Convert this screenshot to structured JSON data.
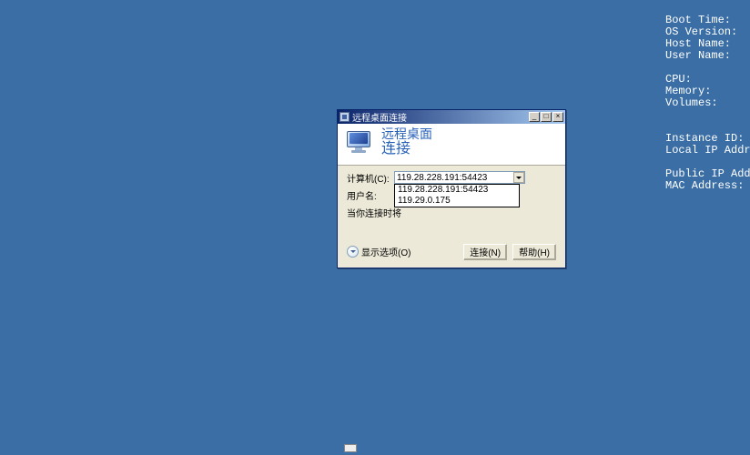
{
  "desktop_info": {
    "lines": [
      "Boot Time:",
      "OS Version:",
      "Host Name:",
      "User Name:",
      "",
      "CPU:",
      "Memory:",
      "Volumes:",
      "",
      "",
      "Instance ID:",
      "Local IP Address:",
      "",
      "Public IP Addre",
      "MAC Address:"
    ]
  },
  "dialog": {
    "title": "远程桌面连接",
    "banner": {
      "line1": "远程桌面",
      "line2": "连接"
    },
    "form": {
      "computer_label": "计算机(C):",
      "computer_value": "119.28.228.191:54423",
      "username_label": "用户名:",
      "username_value": "",
      "hint": "当你连接时将",
      "dropdown_options": [
        "119.28.228.191:54423",
        "119.29.0.175"
      ]
    },
    "buttons": {
      "options": "显示选项(O)",
      "connect": "连接(N)",
      "help": "帮助(H)"
    },
    "window_controls": {
      "minimize": "_",
      "maximize": "□",
      "close": "×"
    }
  }
}
